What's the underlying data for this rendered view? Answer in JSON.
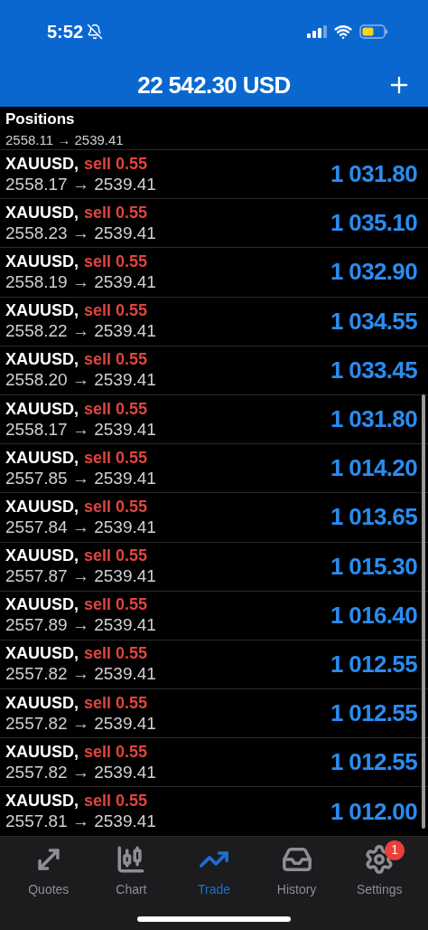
{
  "status_bar": {
    "time": "5:52"
  },
  "header": {
    "balance": "22 542.30 USD"
  },
  "section": {
    "title": "Positions"
  },
  "partial_row": {
    "prices": "2558.11 → 2539.41"
  },
  "positions": [
    {
      "symbol": "XAUUSD,",
      "order": "sell 0.55",
      "prices": "2558.17 → 2539.41",
      "profit": "1 031.80"
    },
    {
      "symbol": "XAUUSD,",
      "order": "sell 0.55",
      "prices": "2558.23 → 2539.41",
      "profit": "1 035.10"
    },
    {
      "symbol": "XAUUSD,",
      "order": "sell 0.55",
      "prices": "2558.19 → 2539.41",
      "profit": "1 032.90"
    },
    {
      "symbol": "XAUUSD,",
      "order": "sell 0.55",
      "prices": "2558.22 → 2539.41",
      "profit": "1 034.55"
    },
    {
      "symbol": "XAUUSD,",
      "order": "sell 0.55",
      "prices": "2558.20 → 2539.41",
      "profit": "1 033.45"
    },
    {
      "symbol": "XAUUSD,",
      "order": "sell 0.55",
      "prices": "2558.17 → 2539.41",
      "profit": "1 031.80"
    },
    {
      "symbol": "XAUUSD,",
      "order": "sell 0.55",
      "prices": "2557.85 → 2539.41",
      "profit": "1 014.20"
    },
    {
      "symbol": "XAUUSD,",
      "order": "sell 0.55",
      "prices": "2557.84 → 2539.41",
      "profit": "1 013.65"
    },
    {
      "symbol": "XAUUSD,",
      "order": "sell 0.55",
      "prices": "2557.87 → 2539.41",
      "profit": "1 015.30"
    },
    {
      "symbol": "XAUUSD,",
      "order": "sell 0.55",
      "prices": "2557.89 → 2539.41",
      "profit": "1 016.40"
    },
    {
      "symbol": "XAUUSD,",
      "order": "sell 0.55",
      "prices": "2557.82 → 2539.41",
      "profit": "1 012.55"
    },
    {
      "symbol": "XAUUSD,",
      "order": "sell 0.55",
      "prices": "2557.82 → 2539.41",
      "profit": "1 012.55"
    },
    {
      "symbol": "XAUUSD,",
      "order": "sell 0.55",
      "prices": "2557.82 → 2539.41",
      "profit": "1 012.55"
    },
    {
      "symbol": "XAUUSD,",
      "order": "sell 0.55",
      "prices": "2557.81 → 2539.41",
      "profit": "1 012.00"
    }
  ],
  "tab_bar": [
    {
      "kind": "quotes",
      "label": "Quotes",
      "selected": false
    },
    {
      "kind": "chart",
      "label": "Chart",
      "selected": false
    },
    {
      "kind": "trade",
      "label": "Trade",
      "selected": true
    },
    {
      "kind": "history",
      "label": "History",
      "selected": false
    },
    {
      "kind": "settings",
      "label": "Settings",
      "selected": false,
      "badge": "1"
    }
  ]
}
